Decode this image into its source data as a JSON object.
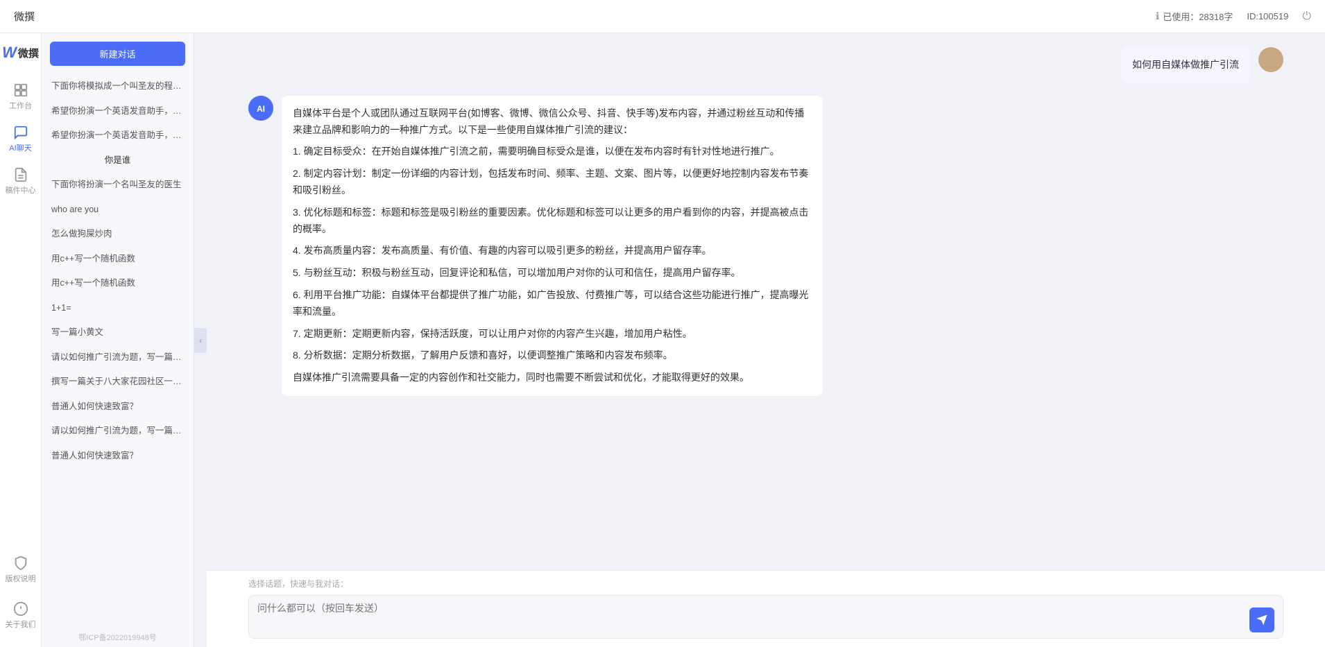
{
  "topbar": {
    "title": "微撰",
    "usage_label": "已使用：28318字",
    "id_label": "ID:100519"
  },
  "logo": {
    "w": "W",
    "text": "微撰"
  },
  "nav": {
    "items": [
      {
        "id": "workbench",
        "label": "工作台",
        "icon": "grid"
      },
      {
        "id": "ai-chat",
        "label": "AI聊天",
        "icon": "chat",
        "active": true
      },
      {
        "id": "drafts",
        "label": "稿件中心",
        "icon": "file"
      }
    ],
    "bottom_items": [
      {
        "id": "copyright",
        "label": "版权说明",
        "icon": "shield"
      },
      {
        "id": "about",
        "label": "关于我们",
        "icon": "info"
      }
    ]
  },
  "conv_panel": {
    "new_btn_label": "新建对话",
    "items": [
      {
        "text": "下面你将模拟成一个叫圣友的程序员，我说...",
        "is_title": false
      },
      {
        "text": "希望你扮演一个英语发音助手，我提供给你...",
        "is_title": false
      },
      {
        "text": "希望你扮演一个英语发音助手，我提供给你...",
        "is_title": false
      },
      {
        "text": "你是谁",
        "is_title": true
      },
      {
        "text": "下面你将扮演一个名叫圣友的医生",
        "is_title": false
      },
      {
        "text": "who are you",
        "is_title": false
      },
      {
        "text": "怎么做狗屎炒肉",
        "is_title": false
      },
      {
        "text": "用c++写一个随机函数",
        "is_title": false
      },
      {
        "text": "用c++写一个随机函数",
        "is_title": false
      },
      {
        "text": "1+1=",
        "is_title": false
      },
      {
        "text": "写一篇小黄文",
        "is_title": false
      },
      {
        "text": "请以如何推广引流为题，写一篇大纲",
        "is_title": false
      },
      {
        "text": "撰写一篇关于八大家花园社区一刻钟便民生...",
        "is_title": false
      },
      {
        "text": "普通人如何快速致富？",
        "is_title": false
      },
      {
        "text": "请以如何推广引流为题，写一篇大纲",
        "is_title": false
      },
      {
        "text": "普通人如何快速致富？",
        "is_title": false
      }
    ]
  },
  "chat": {
    "messages": [
      {
        "role": "user",
        "text": "如何用自媒体做推广引流",
        "avatar_type": "user"
      },
      {
        "role": "ai",
        "paragraphs": [
          "自媒体平台是个人或团队通过互联网平台(如博客、微博、微信公众号、抖音、快手等)发布内容，并通过粉丝互动和传播来建立品牌和影响力的一种推广方式。以下是一些使用自媒体推广引流的建议：",
          "1. 确定目标受众：在开始自媒体推广引流之前，需要明确目标受众是谁，以便在发布内容时有针对性地进行推广。",
          "2. 制定内容计划：制定一份详细的内容计划，包括发布时间、频率、主题、文案、图片等，以便更好地控制内容发布节奏和吸引粉丝。",
          "3. 优化标题和标签：标题和标签是吸引粉丝的重要因素。优化标题和标签可以让更多的用户看到你的内容，并提高被点击的概率。",
          "4. 发布高质量内容：发布高质量、有价值、有趣的内容可以吸引更多的粉丝，并提高用户留存率。",
          "5. 与粉丝互动：积极与粉丝互动，回复评论和私信，可以增加用户对你的认可和信任，提高用户留存率。",
          "6. 利用平台推广功能：自媒体平台都提供了推广功能，如广告投放、付费推广等，可以结合这些功能进行推广，提高曝光率和流量。",
          "7. 定期更新：定期更新内容，保持活跃度，可以让用户对你的内容产生兴趣，增加用户粘性。",
          "8. 分析数据：定期分析数据，了解用户反馈和喜好，以便调整推广策略和内容发布频率。",
          "自媒体推广引流需要具备一定的内容创作和社交能力，同时也需要不断尝试和优化，才能取得更好的效果。"
        ]
      }
    ],
    "input_placeholder": "问什么都可以（按回车发送）",
    "quick_topics_label": "选择话题，快速与我对话："
  },
  "footer": {
    "icp": "鄂ICP备2022019948号"
  }
}
